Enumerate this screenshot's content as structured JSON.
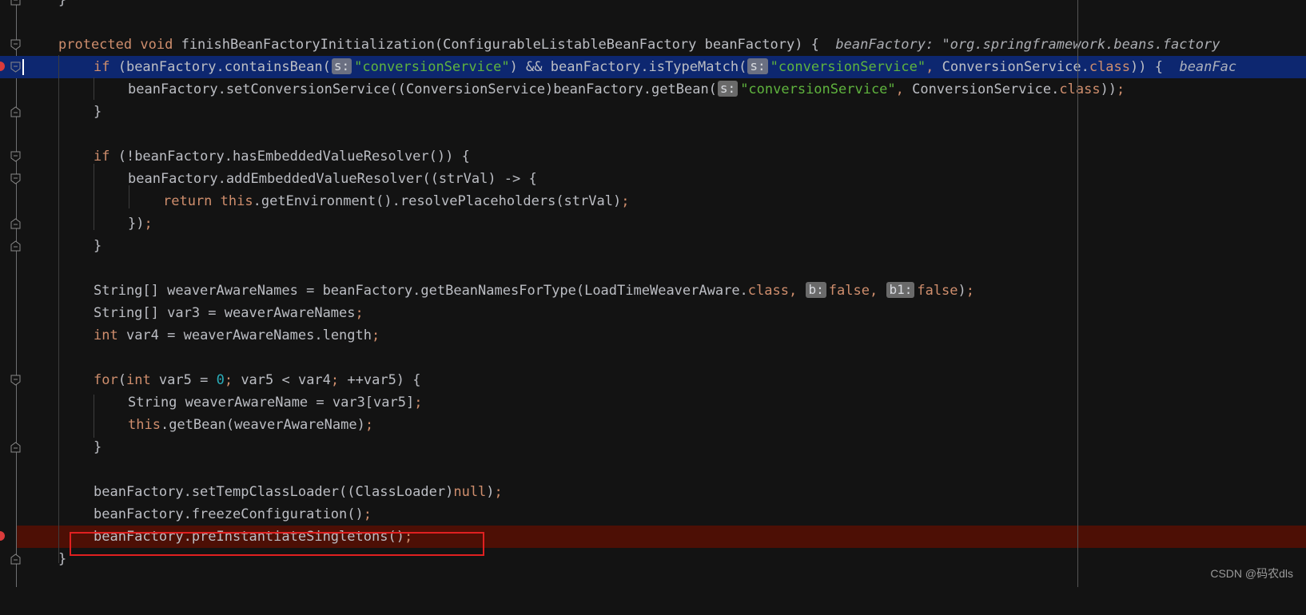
{
  "editor": {
    "lines": [
      {
        "kind": "fold-end",
        "text": "}"
      },
      {
        "kind": "blank"
      },
      {
        "kind": "method-sig",
        "protected": "protected",
        "void": "void",
        "name": "finishBeanFactoryInitialization(ConfigurableListableBeanFactory beanFactory) {",
        "hint": "beanFactory: \"org.springframework.beans.factory"
      },
      {
        "kind": "exec",
        "if": "if",
        "part1": " (beanFactory.containsBean(",
        "hint1": "s:",
        "str1": "\"conversionService\"",
        "part2": ") && beanFactory.isTypeMatch(",
        "hint2": "s:",
        "str2": "\"conversionService\"",
        "comma": ",",
        "part3": " ConversionService.",
        "cls": "class",
        "part4": ")) {",
        "hint": "beanFac"
      },
      {
        "kind": "stmt",
        "part1": "beanFactory.setConversionService((ConversionService)beanFactory.getBean(",
        "hint1": "s:",
        "str1": "\"conversionService\"",
        "comma": ",",
        "part2": " ConversionService.",
        "cls": "class",
        "part3": "))",
        "semi": ";"
      },
      {
        "kind": "close",
        "text": "}"
      },
      {
        "kind": "blank"
      },
      {
        "kind": "if2",
        "if": "if",
        "rest": " (!beanFactory.hasEmbeddedValueResolver()) {"
      },
      {
        "kind": "stmt",
        "text": "beanFactory.addEmbeddedValueResolver((strVal) -> {"
      },
      {
        "kind": "return",
        "return": "return",
        "this": "this",
        "rest": ".getEnvironment().resolvePlaceholders(strVal)",
        "semi": ";"
      },
      {
        "kind": "close",
        "text": "})",
        "semi": ";"
      },
      {
        "kind": "close",
        "text": "}"
      },
      {
        "kind": "blank"
      },
      {
        "kind": "decl",
        "text": "String[] weaverAwareNames = beanFactory.getBeanNamesForType(LoadTimeWeaverAware.",
        "cls": "class",
        "comma1": ",",
        "hint1": "b:",
        "val1": "false",
        "comma2": ",",
        "hint2": "b1:",
        "val2": "false",
        "close": ")",
        "semi": ";"
      },
      {
        "kind": "decl2",
        "text": "String[] var3 = weaverAwareNames",
        "semi": ";"
      },
      {
        "kind": "decl3",
        "int": "int",
        "text": " var4 = weaverAwareNames.length",
        "semi": ";"
      },
      {
        "kind": "blank"
      },
      {
        "kind": "for",
        "for": "for",
        "open": "(",
        "int": "int",
        "a": " var5 = ",
        "zero": "0",
        "s1": ";",
        "b": " var5 < var4",
        "s2": ";",
        "c": " ++var5) {"
      },
      {
        "kind": "stmt",
        "text": "String weaverAwareName = var3[var5]",
        "semi": ";"
      },
      {
        "kind": "this",
        "this": "this",
        "rest": ".getBean(weaverAwareName)",
        "semi": ";"
      },
      {
        "kind": "close",
        "text": "}"
      },
      {
        "kind": "blank"
      },
      {
        "kind": "stmt",
        "text": "beanFactory.setTempClassLoader((ClassLoader)",
        "null": "null",
        "close": ")",
        "semi": ";"
      },
      {
        "kind": "stmt",
        "text": "beanFactory.freezeConfiguration()",
        "semi": ";"
      },
      {
        "kind": "bp",
        "text": "beanFactory.preInstantiateSingletons()",
        "semi": ";"
      },
      {
        "kind": "fold-end",
        "text": "}"
      }
    ]
  },
  "watermark": "CSDN @码农dls"
}
